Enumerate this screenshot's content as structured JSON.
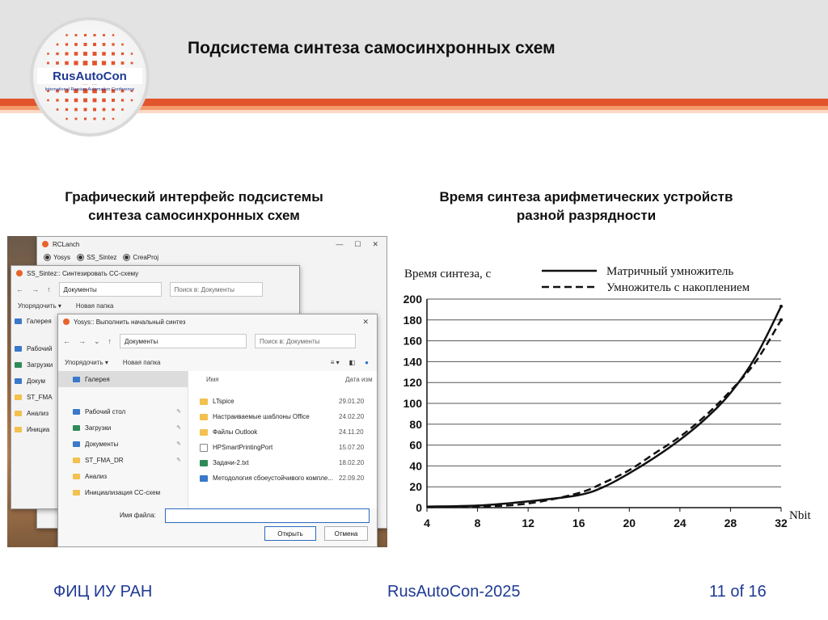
{
  "header": {
    "title": "Подсистема синтеза самосинхронных схем",
    "logo_text": "RusAutoCon",
    "logo_subtext": "International Russian Automation Conference"
  },
  "left_panel": {
    "caption_line1": "Графический интерфейс подсистемы",
    "caption_line2": "синтеза самосинхронных схем"
  },
  "right_panel": {
    "caption_line1": "Время синтеза арифметических устройств",
    "caption_line2": "разной разрядности"
  },
  "footer": {
    "left": "ФИЦ ИУ РАН",
    "center": "RusAutoCon-2025",
    "right": "11 of 16"
  },
  "screenshot": {
    "launcher": {
      "title": "RCLanch",
      "options": [
        "Yosys",
        "SS_Sintez",
        "CreaProj"
      ],
      "controls": [
        "—",
        "☐",
        "✕"
      ]
    },
    "dialog1": {
      "title": "SS_Sintez:: Синтезировать СС-схему",
      "path": "Документы",
      "search_placeholder": "Поиск в: Документы",
      "organize": "Упорядочить ▾",
      "new_folder": "Новая папка",
      "side_items": [
        "Галерея",
        "Рабочий",
        "Загрузки",
        "Докум",
        "ST_FMA",
        "Анализ",
        "Инициа"
      ]
    },
    "dialog2": {
      "title": "Yosys:: Выполнить начальный синтез",
      "path": "Документы",
      "search_placeholder": "Поиск в: Документы",
      "organize": "Упорядочить ▾",
      "new_folder": "Новая папка",
      "side_items": [
        {
          "label": "Галерея",
          "icon": "gallery-icon"
        },
        {
          "label": "Рабочий стол",
          "icon": "desktop-icon"
        },
        {
          "label": "Загрузки",
          "icon": "download-icon"
        },
        {
          "label": "Документы",
          "icon": "documents-icon"
        },
        {
          "label": "ST_FMA_DR",
          "icon": "folder-icon"
        },
        {
          "label": "Анализ",
          "icon": "folder-icon"
        },
        {
          "label": "Инициализация СС-схем",
          "icon": "folder-icon"
        }
      ],
      "col_name": "Имя",
      "col_date": "Дата изм",
      "files": [
        {
          "name": "LTspice",
          "date": "29.01.20",
          "icon": "folder-icon"
        },
        {
          "name": "Настраиваемые шаблоны Office",
          "date": "24.02.20",
          "icon": "folder-icon"
        },
        {
          "name": "Файлы Outlook",
          "date": "24.11.20",
          "icon": "folder-icon"
        },
        {
          "name": "HPSmartPrintingPort",
          "date": "15.07.20",
          "icon": "file-icon"
        },
        {
          "name": "Задачи-2.txt",
          "date": "18.02.20",
          "icon": "text-file-icon"
        },
        {
          "name": "Методология сбоеустойчивого компле...",
          "date": "22.09.20",
          "icon": "word-file-icon"
        }
      ],
      "filename_label": "Имя файла:",
      "filename_value": "",
      "open_label": "Открыть",
      "cancel_label": "Отмена"
    }
  },
  "chart_data": {
    "type": "line",
    "title": "",
    "ylabel": "Время синтеза, с",
    "xlabel": "Nbit",
    "xlim": [
      4,
      32
    ],
    "ylim": [
      0,
      200
    ],
    "xticks": [
      4,
      8,
      12,
      16,
      20,
      24,
      28,
      32
    ],
    "yticks": [
      0,
      20,
      40,
      60,
      80,
      100,
      120,
      140,
      160,
      180,
      200
    ],
    "grid": "horizontal",
    "legend_position": "top-right",
    "series": [
      {
        "name": "Матричный умножитель",
        "style": "solid",
        "x": [
          4,
          8,
          12,
          16,
          18,
          20,
          22,
          24,
          26,
          28,
          30,
          32
        ],
        "y": [
          1,
          2,
          6,
          12,
          20,
          33,
          48,
          65,
          85,
          110,
          145,
          193
        ]
      },
      {
        "name": "Умножитель с накоплением",
        "style": "dashed",
        "x": [
          4,
          8,
          12,
          16,
          18,
          20,
          22,
          24,
          26,
          28,
          30,
          32
        ],
        "y": [
          0.5,
          1,
          4,
          14,
          24,
          36,
          52,
          68,
          88,
          112,
          140,
          180
        ]
      }
    ],
    "colors": {
      "line": "#111111",
      "grid": "#555555"
    }
  }
}
